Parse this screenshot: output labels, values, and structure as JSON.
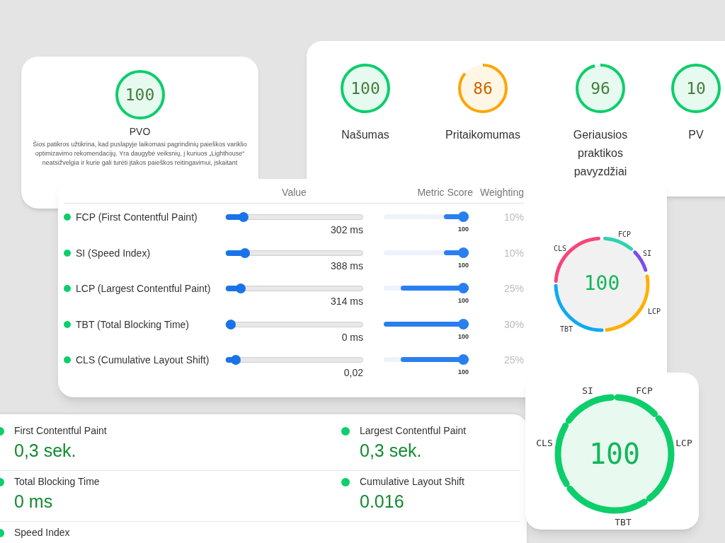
{
  "pvo_card": {
    "score": "100",
    "level": 1,
    "color": "#0cce6b",
    "title": "PVO",
    "description": "Šios patikros užtikrina, kad puslapyje laikomasi pagrindinių paieškos variklio optimizavimo rekomendacijų. Yra daugybė veiksnių, į kuriuos „Lighthouse“ neatsižvelgia ir kurie gali turėti įtakos paieškos reitingavimui, įskaitant"
  },
  "categories": [
    {
      "score": "100",
      "level": 1,
      "color": "#0cce6b",
      "label": "Našumas"
    },
    {
      "score": "86",
      "level": 0.86,
      "color": "#ffa400",
      "label": "Pritaikomumas"
    },
    {
      "score": "96",
      "level": 0.96,
      "color": "#0cce6b",
      "label": "Geriausios praktikos pavyzdžiai"
    },
    {
      "score": "10",
      "level": 1,
      "color": "#0cce6b",
      "label": "PV"
    }
  ],
  "metrics_table": {
    "columns": [
      "Value",
      "Metric Score",
      "Weighting"
    ],
    "rows": [
      {
        "name": "FCP (First Contentful Paint)",
        "value_slider": {
          "level": 0.1
        },
        "value": "302 ms",
        "score_bar": {
          "level": 0.29
        },
        "score": "100",
        "weighting": "10%"
      },
      {
        "name": "SI (Speed Index)",
        "value_slider": {
          "level": 0.11
        },
        "value": "388 ms",
        "score_bar": {
          "level": 0.29
        },
        "score": "100",
        "weighting": "10%"
      },
      {
        "name": "LCP (Largest Contentful Paint)",
        "value_slider": {
          "level": 0.08
        },
        "value": "314 ms",
        "score_bar": {
          "level": 0.8
        },
        "score": "100",
        "weighting": "25%"
      },
      {
        "name": "TBT (Total Blocking Time)",
        "value_slider": {
          "level": 0
        },
        "value": "0 ms",
        "score_bar": {
          "level": 1
        },
        "score": "100",
        "weighting": "30%"
      },
      {
        "name": "CLS (Cumulative Layout Shift)",
        "value_slider": {
          "level": 0.04
        },
        "value": "0,02",
        "score_bar": {
          "level": 0.8
        },
        "score": "100",
        "weighting": "25%"
      }
    ],
    "gauge": {
      "score": "100",
      "segments": [
        {
          "label": "FCP",
          "color": "#2ed3b0"
        },
        {
          "label": "SI",
          "color": "#7b4fe8"
        },
        {
          "label": "LCP",
          "color": "#ffb000"
        },
        {
          "label": "TBT",
          "color": "#10a9f0"
        },
        {
          "label": "CLS",
          "color": "#f7447a"
        }
      ]
    }
  },
  "metrics_summary": {
    "items": [
      {
        "label": "First Contentful Paint",
        "value": "0,3 sek."
      },
      {
        "label": "Largest Contentful Paint",
        "value": "0,3 sek."
      },
      {
        "label": "Total Blocking Time",
        "value": "0 ms"
      },
      {
        "label": "Cumulative Layout Shift",
        "value": "0.016"
      },
      {
        "label": "Speed Index"
      }
    ]
  },
  "performance_gauge": {
    "score": "100",
    "labels": [
      "SI",
      "FCP",
      "LCP",
      "TBT",
      "CLS"
    ]
  }
}
